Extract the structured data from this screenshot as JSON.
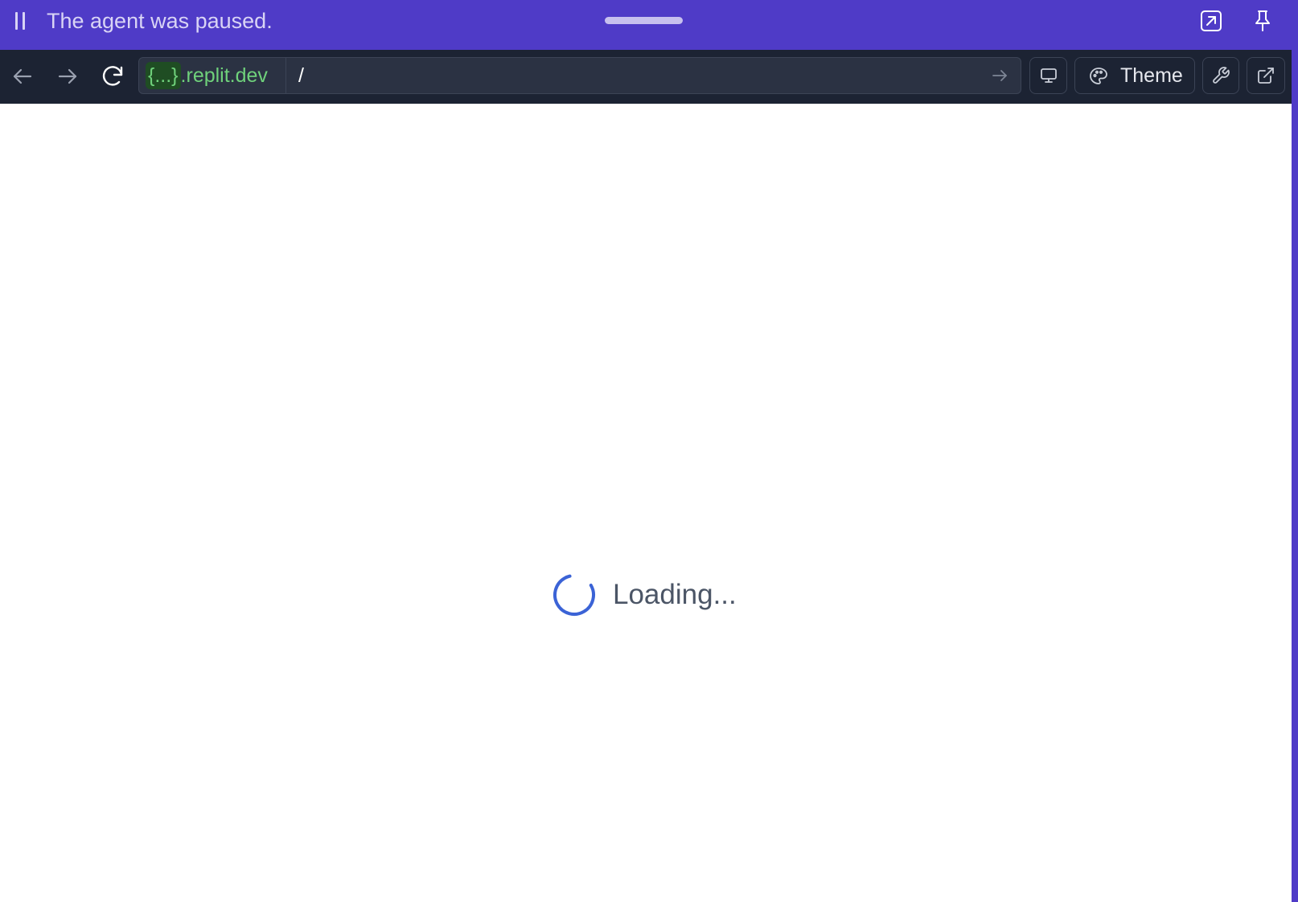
{
  "agent_bar": {
    "status_text": "The agent was paused.",
    "icons": [
      "pause-icon",
      "expand-diagonal-icon",
      "pin-icon"
    ],
    "background": "#4f3bc7"
  },
  "toolbar": {
    "nav_icons": [
      "back-arrow-icon",
      "forward-arrow-icon",
      "reload-icon"
    ],
    "url": {
      "domain_token": "{...}",
      "domain_suffix": ".replit.dev",
      "path": "/"
    },
    "buttons": {
      "theme_label": "Theme"
    },
    "icons": [
      "go-arrow-icon",
      "monitor-icon",
      "palette-icon",
      "wrench-icon",
      "external-link-icon"
    ],
    "background": "#1c2333"
  },
  "content": {
    "loading_text": "Loading...",
    "spinner_color": "#3b63d6"
  }
}
